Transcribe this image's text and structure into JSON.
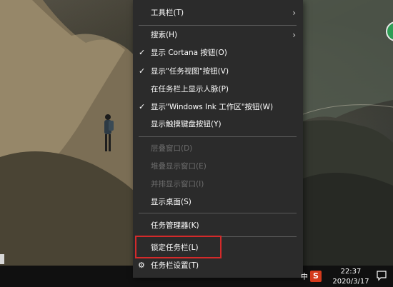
{
  "menu": {
    "items": [
      {
        "label": "工具栏(T)",
        "checked": false,
        "submenu": true,
        "disabled": false
      },
      {
        "label": "搜索(H)",
        "checked": false,
        "submenu": true,
        "disabled": false
      },
      {
        "label": "显示 Cortana 按钮(O)",
        "checked": true,
        "submenu": false,
        "disabled": false
      },
      {
        "label": "显示\"任务视图\"按钮(V)",
        "checked": true,
        "submenu": false,
        "disabled": false
      },
      {
        "label": "在任务栏上显示人脉(P)",
        "checked": false,
        "submenu": false,
        "disabled": false
      },
      {
        "label": "显示\"Windows Ink 工作区\"按钮(W)",
        "checked": true,
        "submenu": false,
        "disabled": false
      },
      {
        "label": "显示触摸键盘按钮(Y)",
        "checked": false,
        "submenu": false,
        "disabled": false
      },
      {
        "label": "层叠窗口(D)",
        "checked": false,
        "submenu": false,
        "disabled": true
      },
      {
        "label": "堆叠显示窗口(E)",
        "checked": false,
        "submenu": false,
        "disabled": true
      },
      {
        "label": "并排显示窗口(I)",
        "checked": false,
        "submenu": false,
        "disabled": true
      },
      {
        "label": "显示桌面(S)",
        "checked": false,
        "submenu": false,
        "disabled": false
      },
      {
        "label": "任务管理器(K)",
        "checked": false,
        "submenu": false,
        "disabled": false
      },
      {
        "label": "锁定任务栏(L)",
        "checked": false,
        "submenu": false,
        "disabled": false
      },
      {
        "label": "任务栏设置(T)",
        "checked": false,
        "submenu": false,
        "disabled": false
      }
    ],
    "check_glyph": "✓",
    "arrow_glyph": "›",
    "gear_glyph": "⚙",
    "highlight_color": "#d42a2a"
  },
  "taskbar": {
    "time": "22:37",
    "date": "2020/3/17",
    "ime_label": "S",
    "ime_small": "中",
    "notification_icon": "action-center-icon"
  }
}
